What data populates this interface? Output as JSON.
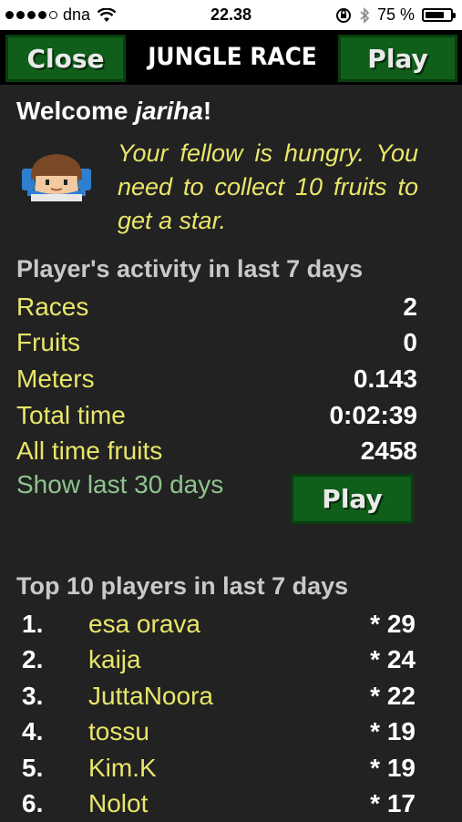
{
  "status_bar": {
    "carrier": "dna",
    "time": "22.38",
    "battery": "75 %",
    "battery_level": 0.75
  },
  "header": {
    "close_label": "Close",
    "title": "JUNGLE RACE",
    "play_label": "Play"
  },
  "welcome": {
    "prefix": "Welcome ",
    "username": "jariha",
    "suffix": "!"
  },
  "message": "Your fellow is hungry. You need to collect 10 fruits to get a star.",
  "activity": {
    "title": "Player's activity in last 7 days",
    "rows": [
      {
        "label": "Races",
        "value": "2"
      },
      {
        "label": "Fruits",
        "value": "0"
      },
      {
        "label": "Meters",
        "value": "0.143"
      },
      {
        "label": "Total time",
        "value": "0:02:39"
      },
      {
        "label": "All time fruits",
        "value": "2458"
      }
    ],
    "show_link": "Show last 30 days",
    "play_label": "Play"
  },
  "top_players": {
    "title": "Top 10 players in last 7 days",
    "rows": [
      {
        "rank": "1.",
        "name": "esa orava",
        "score": "* 29"
      },
      {
        "rank": "2.",
        "name": "kaija",
        "score": "* 24"
      },
      {
        "rank": "3.",
        "name": "JuttaNoora",
        "score": "* 22"
      },
      {
        "rank": "4.",
        "name": "tossu",
        "score": "* 19"
      },
      {
        "rank": "5.",
        "name": "Kim.K",
        "score": "* 19"
      },
      {
        "rank": "6.",
        "name": "Nolot",
        "score": "* 17"
      }
    ]
  }
}
